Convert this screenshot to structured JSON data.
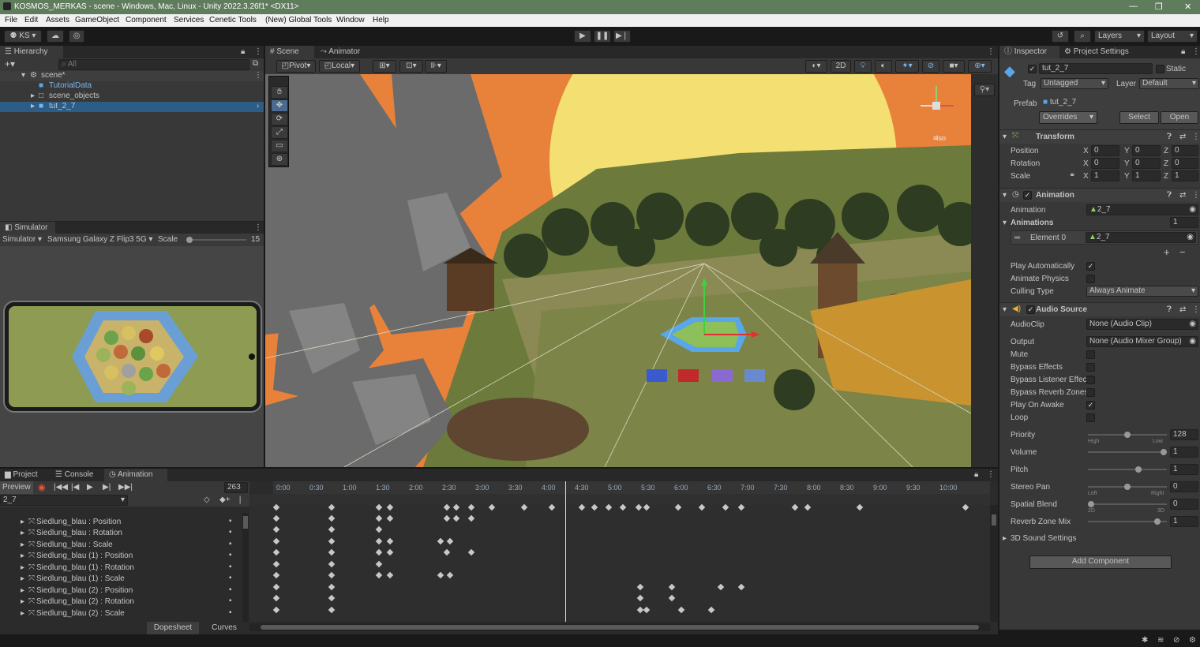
{
  "window": {
    "title": "KOSMOS_MERKAS - scene - Windows, Mac, Linux - Unity 2022.3.26f1* <DX11>",
    "minimize": "—",
    "maximize": "❐",
    "close": "✕"
  },
  "menu": [
    "File",
    "Edit",
    "Assets",
    "GameObject",
    "Component",
    "Services",
    "Cenetic Tools",
    "(New) Global Tools",
    "Window",
    "Help"
  ],
  "toolbar": {
    "account": "KS",
    "layers": "Layers",
    "layout": "Layout"
  },
  "hierarchy": {
    "tab": "Hierarchy",
    "search_placeholder": "All",
    "scene": "scene*",
    "items": [
      "TutorialData",
      "scene_objects",
      "tut_2_7"
    ]
  },
  "simulator": {
    "tab": "Simulator",
    "mode": "Simulator",
    "device": "Samsung Galaxy Z Flip3 5G",
    "scale_label": "Scale",
    "scale_value": "15"
  },
  "scene_view": {
    "tabs": [
      "Scene",
      "Animator"
    ],
    "pivot": "Pivot",
    "local": "Local",
    "mode2d": "2D",
    "iso": "Iso"
  },
  "inspector": {
    "tabs": [
      "Inspector",
      "Project Settings"
    ],
    "object_name": "tut_2_7",
    "static": "Static",
    "tag_label": "Tag",
    "tag": "Untagged",
    "layer_label": "Layer",
    "layer": "Default",
    "prefab_label": "Prefab",
    "prefab": "tut_2_7",
    "overrides": "Overrides",
    "select": "Select",
    "open": "Open",
    "transform": {
      "title": "Transform",
      "position_label": "Position",
      "rotation_label": "Rotation",
      "scale_label": "Scale",
      "x": "X",
      "y": "Y",
      "z": "Z",
      "position": [
        "0",
        "0",
        "0"
      ],
      "rotation": [
        "0",
        "0",
        "0"
      ],
      "scale": [
        "1",
        "1",
        "1"
      ]
    },
    "animation": {
      "title": "Animation",
      "animation_label": "Animation",
      "animation_value": "2_7",
      "animations_label": "Animations",
      "animations_count": "1",
      "element_label": "Element 0",
      "element_value": "2_7",
      "play_auto": "Play Automatically",
      "animate_physics": "Animate Physics",
      "culling_label": "Culling Type",
      "culling_value": "Always Animate"
    },
    "audio": {
      "title": "Audio Source",
      "clip_label": "AudioClip",
      "clip_value": "None (Audio Clip)",
      "output_label": "Output",
      "output_value": "None (Audio Mixer Group)",
      "mute": "Mute",
      "bypass_effects": "Bypass Effects",
      "bypass_listener": "Bypass Listener Effec",
      "bypass_reverb": "Bypass Reverb Zones",
      "play_on_awake": "Play On Awake",
      "loop": "Loop",
      "priority_label": "Priority",
      "priority_value": "128",
      "priority_high": "High",
      "priority_low": "Low",
      "volume_label": "Volume",
      "volume_value": "1",
      "pitch_label": "Pitch",
      "pitch_value": "1",
      "stereo_label": "Stereo Pan",
      "stereo_value": "0",
      "stereo_left": "Left",
      "stereo_right": "Right",
      "spatial_label": "Spatial Blend",
      "spatial_value": "0",
      "spatial_2d": "2D",
      "spatial_3d": "3D",
      "reverb_label": "Reverb Zone Mix",
      "reverb_value": "1",
      "sound_settings": "3D Sound Settings"
    },
    "add_component": "Add Component"
  },
  "animation_window": {
    "tabs": [
      "Project",
      "Console",
      "Animation"
    ],
    "preview": "Preview",
    "frame": "263",
    "clip": "2_7",
    "dopesheet": "Dopesheet",
    "curves": "Curves",
    "ticks": [
      "0:00",
      "0:30",
      "1:00",
      "1:30",
      "2:00",
      "2:30",
      "3:00",
      "3:30",
      "4:00",
      "4:30",
      "5:00",
      "5:30",
      "6:00",
      "6:30",
      "7:00",
      "7:30",
      "8:00",
      "8:30",
      "9:00",
      "9:30",
      "10:00"
    ],
    "properties": [
      "Siedlung_blau : Position",
      "Siedlung_blau : Rotation",
      "Siedlung_blau : Scale",
      "Siedlung_blau (1) : Position",
      "Siedlung_blau (1) : Rotation",
      "Siedlung_blau (1) : Scale",
      "Siedlung_blau (2) : Position",
      "Siedlung_blau (2) : Rotation",
      "Siedlung_blau (2) : Scale"
    ]
  },
  "colors": {
    "title_bar": "#5f7c5c",
    "scene_sky": "#e8823a",
    "sun": "#f3df72",
    "selection": "#2c5d87"
  }
}
